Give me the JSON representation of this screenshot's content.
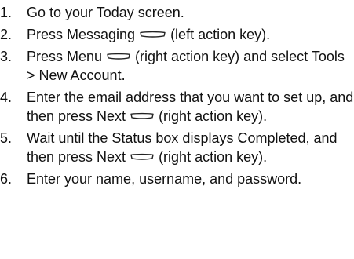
{
  "instructions": {
    "steps": [
      {
        "number": "1.",
        "text": "Go to your Today screen."
      },
      {
        "number": "2.",
        "before": "Press Messaging",
        "after": "(left action key).",
        "icon": "left-action-key-icon"
      },
      {
        "number": "3.",
        "before": "Press Menu",
        "after": "(right action key) and select Tools > New Account.",
        "icon": "right-action-key-icon"
      },
      {
        "number": "4.",
        "before": "Enter the email address that you want to set up, and then press Next",
        "after": "(right action key).",
        "icon": "right-action-key-icon"
      },
      {
        "number": "5.",
        "before": "Wait until the Status box displays Completed, and then press Next",
        "after": "(right action key).",
        "icon": "right-action-key-icon"
      },
      {
        "number": "6.",
        "text": "Enter your name, username, and password."
      }
    ]
  }
}
